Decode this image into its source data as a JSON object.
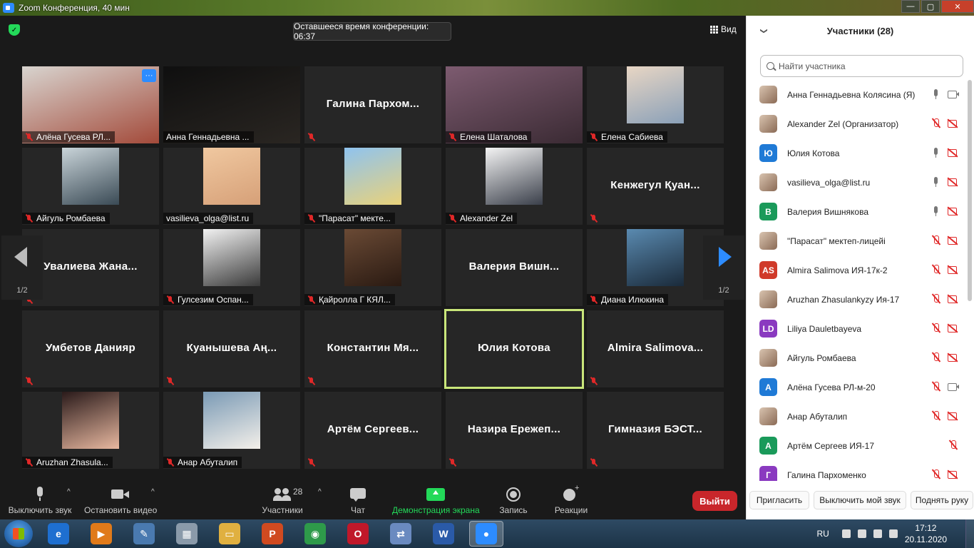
{
  "window": {
    "title": "Zoom Конференция, 40 мин",
    "minimize": "—",
    "maximize": "▢",
    "close": "✕"
  },
  "meeting": {
    "timer": "Оставшееся время конференции: 06:37",
    "view_label": "Вид",
    "page_left": "1/2",
    "page_right": "1/2",
    "more_label": "···",
    "tiles": [
      {
        "label": "Алёна Гусева РЛ...",
        "big": "",
        "muted": true,
        "photo": "wide",
        "c1": "#d8d4cf",
        "c2": "#a34a3a",
        "more": true
      },
      {
        "label": "Анна Геннадьевна ...",
        "big": "",
        "muted": false,
        "photo": "wide",
        "c1": "#0f0f0f",
        "c2": "#2a2622"
      },
      {
        "label": "",
        "big": "Галина  Пархом...",
        "muted": true
      },
      {
        "label": "Елена Шаталова",
        "big": "",
        "muted": true,
        "photo": "wide",
        "c1": "#7d5b70",
        "c2": "#3a2a33"
      },
      {
        "label": "Елена Сабиева",
        "big": "",
        "muted": true,
        "photo": "box",
        "c1": "#e8d6c4",
        "c2": "#8aa0b8"
      },
      {
        "label": "Айгуль Ромбаева",
        "big": "",
        "muted": true,
        "photo": "box",
        "c1": "#c9d4d9",
        "c2": "#3a4a55"
      },
      {
        "label": "vasilieva_olga@list.ru",
        "big": "",
        "muted": false,
        "photo": "box",
        "c1": "#f0c8a0",
        "c2": "#d6a078"
      },
      {
        "label": "\"Парасат\" мектe...",
        "big": "",
        "muted": true,
        "photo": "box",
        "c1": "#8fc3ef",
        "c2": "#e9d27a"
      },
      {
        "label": "Alexander Zel",
        "big": "",
        "muted": true,
        "photo": "box",
        "c1": "#f4f4f4",
        "c2": "#3a3f4a"
      },
      {
        "label": "",
        "big": "Кенжегул Қуан...",
        "muted": true
      },
      {
        "label": "",
        "big": "Увалиева  Жана...",
        "muted": true
      },
      {
        "label": "Гулсезим Оспан...",
        "big": "",
        "muted": true,
        "photo": "box",
        "c1": "#f2f2f2",
        "c2": "#3a3a3a"
      },
      {
        "label": "Қайролла Г КЯЛ...",
        "big": "",
        "muted": true,
        "photo": "box",
        "c1": "#6a4a35",
        "c2": "#2a1a12"
      },
      {
        "label": "",
        "big": "Валерия  Вишн...",
        "muted": false
      },
      {
        "label": "Диана Илюкина",
        "big": "",
        "muted": true,
        "photo": "box",
        "c1": "#5a8ab0",
        "c2": "#1a2a3a"
      },
      {
        "label": "",
        "big": "Умбетов Данияр",
        "muted": true
      },
      {
        "label": "",
        "big": "Куанышева  Аң...",
        "muted": true
      },
      {
        "label": "",
        "big": "Константин  Мя...",
        "muted": true
      },
      {
        "label": "",
        "big": "Юлия Котова",
        "muted": false,
        "active": true
      },
      {
        "label": "",
        "big": "Almira  Salimova...",
        "muted": true
      },
      {
        "label": "Aruzhan Zhasula...",
        "big": "",
        "muted": true,
        "photo": "box",
        "c1": "#2a1a1a",
        "c2": "#e8b8a0"
      },
      {
        "label": "Анар Абуталип",
        "big": "",
        "muted": true,
        "photo": "box",
        "c1": "#7a9ab5",
        "c2": "#f4f0ea"
      },
      {
        "label": "",
        "big": "Артём  Сергеев...",
        "muted": true
      },
      {
        "label": "",
        "big": "Назира  Ережеп...",
        "muted": true
      },
      {
        "label": "",
        "big": "Гимназия  БЭСТ...",
        "muted": true
      }
    ]
  },
  "toolbar": {
    "mute_label": "Выключить звук",
    "video_label": "Остановить видео",
    "participants_label": "Участники",
    "participants_count": "28",
    "chat_label": "Чат",
    "share_label": "Демонстрация экрана",
    "record_label": "Запись",
    "reactions_label": "Реакции",
    "leave_label": "Выйти",
    "caret": "^"
  },
  "panel": {
    "title": "Участники (28)",
    "collapse": "❯",
    "search_placeholder": "Найти участника",
    "participants": [
      {
        "name": "Анна Геннадьевна Колясина (Я)",
        "avatar": "",
        "color": "",
        "mic": "mic",
        "cam": "cam"
      },
      {
        "name": "Alexander Zel (Организатор)",
        "avatar": "",
        "color": "",
        "mic": "micoff",
        "cam": "camoff"
      },
      {
        "name": "Юлия Котова",
        "avatar": "Ю",
        "color": "#1f7ad6",
        "mic": "mic",
        "cam": "camoff"
      },
      {
        "name": "vasilieva_olga@list.ru",
        "avatar": "",
        "color": "",
        "mic": "mic",
        "cam": "camoff"
      },
      {
        "name": "Валерия Вишнякова",
        "avatar": "В",
        "color": "#1a9a5a",
        "mic": "mic",
        "cam": "camoff"
      },
      {
        "name": "\"Парасат\" мектеп-лицейі",
        "avatar": "",
        "color": "",
        "mic": "micoff",
        "cam": "camoff"
      },
      {
        "name": "Almira Salimova ИЯ-17к-2",
        "avatar": "AS",
        "color": "#d03a2a",
        "mic": "micoff",
        "cam": "camoff"
      },
      {
        "name": "Aruzhan Zhasulankyzy Ия-17",
        "avatar": "",
        "color": "",
        "mic": "micoff",
        "cam": "camoff"
      },
      {
        "name": "Liliya Dauletbayeva",
        "avatar": "LD",
        "color": "#8a3ac0",
        "mic": "micoff",
        "cam": "camoff"
      },
      {
        "name": "Айгуль Ромбаева",
        "avatar": "",
        "color": "",
        "mic": "micoff",
        "cam": "camoff"
      },
      {
        "name": "Алёна Гусева РЛ-м-20",
        "avatar": "А",
        "color": "#1f7ad6",
        "mic": "micoff",
        "cam": "cam"
      },
      {
        "name": "Анар Абуталип",
        "avatar": "",
        "color": "",
        "mic": "micoff",
        "cam": "camoff"
      },
      {
        "name": "Артём Сергеев ИЯ-17",
        "avatar": "А",
        "color": "#1a9a5a",
        "mic": "blank",
        "cam": "micoff"
      },
      {
        "name": "Галина Пархоменко",
        "avatar": "Г",
        "color": "#8a3ac0",
        "mic": "micoff",
        "cam": "camoff"
      }
    ],
    "invite_label": "Пригласить",
    "mute_all_label": "Выключить мой звук",
    "raise_hand_label": "Поднять руку"
  },
  "taskbar": {
    "apps": [
      {
        "name": "internet-explorer-icon",
        "glyph": "e",
        "color": "#1e6fd0"
      },
      {
        "name": "media-player-icon",
        "glyph": "▶",
        "color": "#e07a1a"
      },
      {
        "name": "scanner-icon",
        "glyph": "✎",
        "color": "#4a7ab0"
      },
      {
        "name": "calculator-icon",
        "glyph": "▦",
        "color": "#8a9aaa"
      },
      {
        "name": "explorer-icon",
        "glyph": "▭",
        "color": "#e0b040"
      },
      {
        "name": "powerpoint-icon",
        "glyph": "P",
        "color": "#d04a20"
      },
      {
        "name": "chrome-icon",
        "glyph": "◉",
        "color": "#2e9a4a"
      },
      {
        "name": "opera-icon",
        "glyph": "O",
        "color": "#c0182a"
      },
      {
        "name": "folder-sync-icon",
        "glyph": "⇄",
        "color": "#6a8ac0"
      },
      {
        "name": "word-icon",
        "glyph": "W",
        "color": "#2a5aa8"
      },
      {
        "name": "zoom-icon",
        "glyph": "●",
        "color": "#2d8cff"
      }
    ],
    "lang": "RU",
    "time": "17:12",
    "date": "20.11.2020"
  }
}
